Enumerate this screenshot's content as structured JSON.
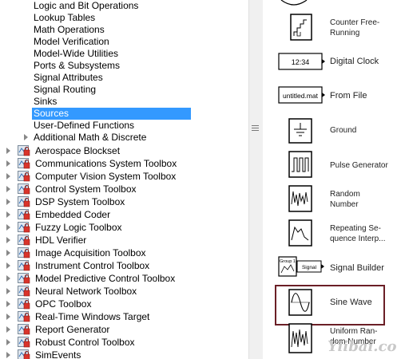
{
  "simulink_lib": {
    "sublists": [
      "Logic and Bit Operations",
      "Lookup Tables",
      "Math Operations",
      "Model Verification",
      "Model-Wide Utilities",
      "Ports & Subsystems",
      "Signal Attributes",
      "Signal Routing",
      "Sinks",
      "Sources",
      "User-Defined Functions",
      "Additional Math & Discrete"
    ],
    "selected": "Sources"
  },
  "libraries": [
    "Aerospace Blockset",
    "Communications System Toolbox",
    "Computer Vision System Toolbox",
    "Control System Toolbox",
    "DSP System Toolbox",
    "Embedded Coder",
    "Fuzzy Logic Toolbox",
    "HDL Verifier",
    "Image Acquisition Toolbox",
    "Instrument Control Toolbox",
    "Model Predictive Control Toolbox",
    "Neural Network Toolbox",
    "OPC Toolbox",
    "Real-Time Windows Target",
    "Report Generator",
    "Robust Control Toolbox",
    "SimEvents"
  ],
  "blocks": {
    "counter_label": "Counter Free-\nRunning",
    "clock_label": "Digital Clock",
    "clock_text": "12:34",
    "file_label": "From File",
    "file_text": "untitled.mat",
    "ground_label": "Ground",
    "pulse_label": "Pulse Generator",
    "random_label": "Random\nNumber",
    "repeating_label": "Repeating Se-\nquence Interp...",
    "sigbuilder_label": "Signal Builder",
    "sigbuilder_text": "Signal",
    "sigbuilder_group": "Group 1",
    "sine_label": "Sine Wave",
    "uniform_label": "Uniform Ran-\ndom Number"
  },
  "watermark": "Yiibai.com",
  "colors": {
    "selection": "#3399ff",
    "highlight_border": "#6b1f26"
  }
}
